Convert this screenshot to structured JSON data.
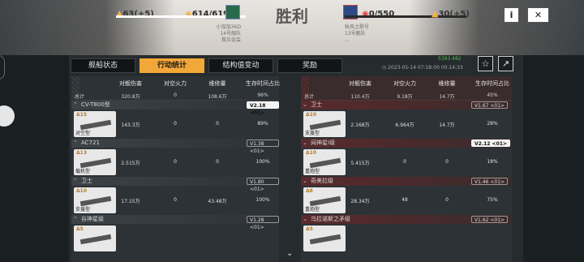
{
  "header": {
    "title": "胜利",
    "left": {
      "supply": "63(+5)",
      "points": "614/619",
      "notes": [
        "小加加36D",
        "14号舰队",
        "救兵议会"
      ]
    },
    "right": {
      "points": "0/550",
      "supply": "30(+5)",
      "notes": [
        "秋风之歌号",
        "13号舰队",
        "..."
      ]
    },
    "info_label": "i",
    "close_label": "✕"
  },
  "tabs": [
    "舰船状态",
    "行动统计",
    "结构值变动",
    "奖励"
  ],
  "meta": {
    "resource": "5393.482",
    "time": "2023-05-14 07:58:00",
    "duration": "00:14:33"
  },
  "columns": [
    "对舰伤害",
    "对空火力",
    "维修量",
    "生存时间占比"
  ],
  "totals_label": "总计",
  "left_totals": [
    "320.8万",
    "0",
    "108.6万",
    "96%"
  ],
  "right_totals": [
    "110.4万",
    "9.18万",
    "14.7万",
    "45%"
  ],
  "left_ships": [
    {
      "name": "CV-T800型",
      "ver": "V2.18 <01>",
      "hl": true,
      "level": "Δ15",
      "cls": "对空型",
      "vals": [
        "143.3万",
        "0",
        "0",
        "89%"
      ]
    },
    {
      "name": "AC721",
      "ver": "V1.38 <01>",
      "hl": false,
      "level": "Δ13",
      "cls": "载机型",
      "vals": [
        "2.515万",
        "0",
        "0",
        "100%"
      ]
    },
    {
      "name": "卫士",
      "ver": "V1.80 <01>",
      "hl": false,
      "level": "Δ10",
      "cls": "支援型",
      "vals": [
        "17.15万",
        "0",
        "43.48万",
        "100%"
      ]
    },
    {
      "name": "谷神星级",
      "ver": "V1.28 <01>",
      "hl": false,
      "level": "Δ5",
      "cls": "",
      "vals": [
        "",
        "",
        "",
        ""
      ]
    }
  ],
  "right_ships": [
    {
      "name": "卫士",
      "ver": "V1.67 <01>",
      "hl": false,
      "level": "Δ10",
      "cls": "支援型",
      "vals": [
        "2.168万",
        "6.964万",
        "14.7万",
        "28%"
      ]
    },
    {
      "name": "阋神星I级",
      "ver": "V2.12 <01>",
      "hl": true,
      "level": "Δ10",
      "cls": "重炮型",
      "vals": [
        "5.415万",
        "0",
        "0",
        "18%"
      ]
    },
    {
      "name": "奇美拉级",
      "ver": "V1.46 <01>",
      "hl": false,
      "level": "Δ8",
      "cls": "重炮型",
      "vals": [
        "28.34万",
        "48",
        "0",
        "75%"
      ]
    },
    {
      "name": "乌拉诺斯之矛级",
      "ver": "V1.62 <01>",
      "hl": false,
      "level": "Δ5",
      "cls": "",
      "vals": [
        "",
        "",
        "",
        ""
      ]
    }
  ],
  "icons": [
    "star-icon",
    "share-icon",
    "chevron-down-icon"
  ]
}
